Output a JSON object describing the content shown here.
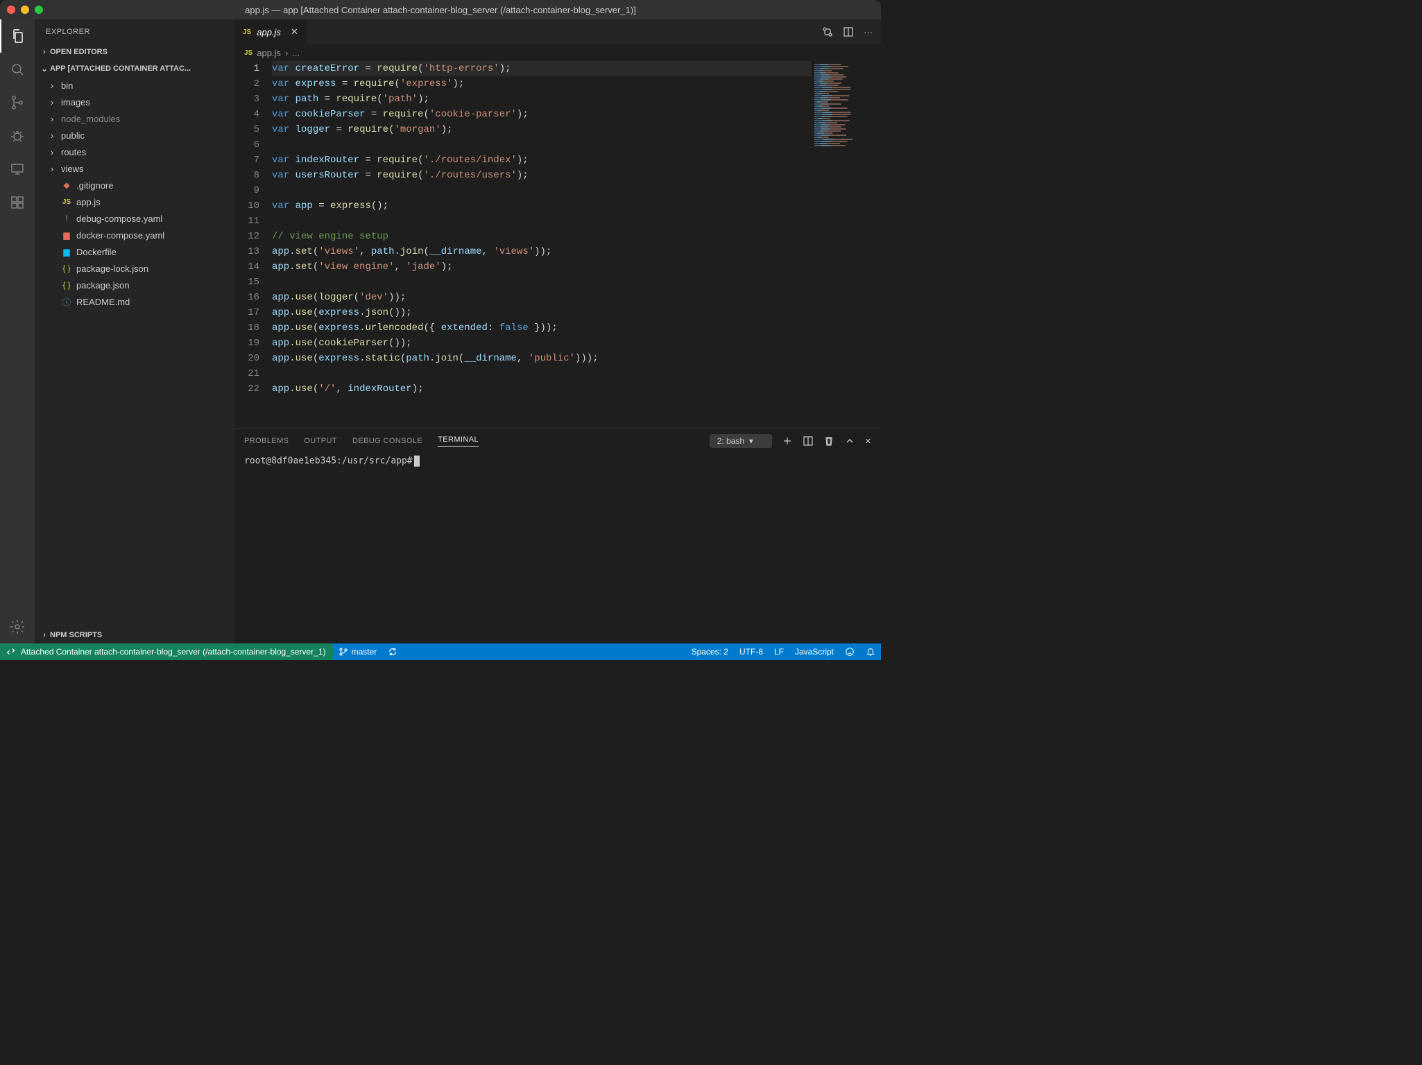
{
  "window": {
    "title": "app.js — app [Attached Container attach-container-blog_server (/attach-container-blog_server_1)]"
  },
  "sidebar": {
    "title": "EXPLORER",
    "open_editors": "OPEN EDITORS",
    "root_label": "APP [ATTACHED CONTAINER ATTAC...",
    "npm_scripts": "NPM SCRIPTS",
    "folders": [
      "bin",
      "images",
      "node_modules",
      "public",
      "routes",
      "views"
    ],
    "files": [
      {
        "name": ".gitignore",
        "icon": "git"
      },
      {
        "name": "app.js",
        "icon": "js"
      },
      {
        "name": "debug-compose.yaml",
        "icon": "yaml"
      },
      {
        "name": "docker-compose.yaml",
        "icon": "docker2"
      },
      {
        "name": "Dockerfile",
        "icon": "docker"
      },
      {
        "name": "package-lock.json",
        "icon": "json"
      },
      {
        "name": "package.json",
        "icon": "json"
      },
      {
        "name": "README.md",
        "icon": "info"
      }
    ]
  },
  "tabs": {
    "active": "app.js"
  },
  "breadcrumb": {
    "file": "app.js",
    "more": "..."
  },
  "code_lines": [
    [
      [
        "kw",
        "var"
      ],
      [
        "",
        " "
      ],
      [
        "id",
        "createError"
      ],
      [
        "",
        " = "
      ],
      [
        "fn",
        "require"
      ],
      [
        "",
        "("
      ],
      [
        "str",
        "'http-errors'"
      ],
      [
        "",
        ");"
      ]
    ],
    [
      [
        "kw",
        "var"
      ],
      [
        "",
        " "
      ],
      [
        "id",
        "express"
      ],
      [
        "",
        " = "
      ],
      [
        "fn",
        "require"
      ],
      [
        "",
        "("
      ],
      [
        "str",
        "'express'"
      ],
      [
        "",
        ");"
      ]
    ],
    [
      [
        "kw",
        "var"
      ],
      [
        "",
        " "
      ],
      [
        "id",
        "path"
      ],
      [
        "",
        " = "
      ],
      [
        "fn",
        "require"
      ],
      [
        "",
        "("
      ],
      [
        "str",
        "'path'"
      ],
      [
        "",
        ");"
      ]
    ],
    [
      [
        "kw",
        "var"
      ],
      [
        "",
        " "
      ],
      [
        "id",
        "cookieParser"
      ],
      [
        "",
        " = "
      ],
      [
        "fn",
        "require"
      ],
      [
        "",
        "("
      ],
      [
        "str",
        "'cookie-parser'"
      ],
      [
        "",
        ");"
      ]
    ],
    [
      [
        "kw",
        "var"
      ],
      [
        "",
        " "
      ],
      [
        "id",
        "logger"
      ],
      [
        "",
        " = "
      ],
      [
        "fn",
        "require"
      ],
      [
        "",
        "("
      ],
      [
        "str",
        "'morgan'"
      ],
      [
        "",
        ");"
      ]
    ],
    [],
    [
      [
        "kw",
        "var"
      ],
      [
        "",
        " "
      ],
      [
        "id",
        "indexRouter"
      ],
      [
        "",
        " = "
      ],
      [
        "fn",
        "require"
      ],
      [
        "",
        "("
      ],
      [
        "str",
        "'./routes/index'"
      ],
      [
        "",
        ");"
      ]
    ],
    [
      [
        "kw",
        "var"
      ],
      [
        "",
        " "
      ],
      [
        "id",
        "usersRouter"
      ],
      [
        "",
        " = "
      ],
      [
        "fn",
        "require"
      ],
      [
        "",
        "("
      ],
      [
        "str",
        "'./routes/users'"
      ],
      [
        "",
        ");"
      ]
    ],
    [],
    [
      [
        "kw",
        "var"
      ],
      [
        "",
        " "
      ],
      [
        "id",
        "app"
      ],
      [
        "",
        " = "
      ],
      [
        "fn",
        "express"
      ],
      [
        "",
        "();"
      ]
    ],
    [],
    [
      [
        "com",
        "// view engine setup"
      ]
    ],
    [
      [
        "id",
        "app"
      ],
      [
        "",
        "."
      ],
      [
        "fn",
        "set"
      ],
      [
        "",
        "("
      ],
      [
        "str",
        "'views'"
      ],
      [
        "",
        ", "
      ],
      [
        "id",
        "path"
      ],
      [
        "",
        "."
      ],
      [
        "fn",
        "join"
      ],
      [
        "",
        "("
      ],
      [
        "id",
        "__dirname"
      ],
      [
        "",
        ", "
      ],
      [
        "str",
        "'views'"
      ],
      [
        "",
        "));"
      ]
    ],
    [
      [
        "id",
        "app"
      ],
      [
        "",
        "."
      ],
      [
        "fn",
        "set"
      ],
      [
        "",
        "("
      ],
      [
        "str",
        "'view engine'"
      ],
      [
        "",
        ", "
      ],
      [
        "str",
        "'jade'"
      ],
      [
        "",
        ");"
      ]
    ],
    [],
    [
      [
        "id",
        "app"
      ],
      [
        "",
        "."
      ],
      [
        "fn",
        "use"
      ],
      [
        "",
        "("
      ],
      [
        "fn",
        "logger"
      ],
      [
        "",
        "("
      ],
      [
        "str",
        "'dev'"
      ],
      [
        "",
        "));"
      ]
    ],
    [
      [
        "id",
        "app"
      ],
      [
        "",
        "."
      ],
      [
        "fn",
        "use"
      ],
      [
        "",
        "("
      ],
      [
        "id",
        "express"
      ],
      [
        "",
        "."
      ],
      [
        "fn",
        "json"
      ],
      [
        "",
        "());"
      ]
    ],
    [
      [
        "id",
        "app"
      ],
      [
        "",
        "."
      ],
      [
        "fn",
        "use"
      ],
      [
        "",
        "("
      ],
      [
        "id",
        "express"
      ],
      [
        "",
        "."
      ],
      [
        "fn",
        "urlencoded"
      ],
      [
        "",
        "({ "
      ],
      [
        "id",
        "extended"
      ],
      [
        "",
        ": "
      ],
      [
        "kw",
        "false"
      ],
      [
        "",
        " }));"
      ]
    ],
    [
      [
        "id",
        "app"
      ],
      [
        "",
        "."
      ],
      [
        "fn",
        "use"
      ],
      [
        "",
        "("
      ],
      [
        "fn",
        "cookieParser"
      ],
      [
        "",
        "());"
      ]
    ],
    [
      [
        "id",
        "app"
      ],
      [
        "",
        "."
      ],
      [
        "fn",
        "use"
      ],
      [
        "",
        "("
      ],
      [
        "id",
        "express"
      ],
      [
        "",
        "."
      ],
      [
        "fn",
        "static"
      ],
      [
        "",
        "("
      ],
      [
        "id",
        "path"
      ],
      [
        "",
        "."
      ],
      [
        "fn",
        "join"
      ],
      [
        "",
        "("
      ],
      [
        "id",
        "__dirname"
      ],
      [
        "",
        ", "
      ],
      [
        "str",
        "'public'"
      ],
      [
        "",
        ")));"
      ]
    ],
    [],
    [
      [
        "id",
        "app"
      ],
      [
        "",
        "."
      ],
      [
        "fn",
        "use"
      ],
      [
        "",
        "("
      ],
      [
        "str",
        "'/'"
      ],
      [
        "",
        ", "
      ],
      [
        "id",
        "indexRouter"
      ],
      [
        "",
        ");"
      ]
    ]
  ],
  "panel": {
    "tabs": {
      "problems": "PROBLEMS",
      "output": "OUTPUT",
      "debug": "DEBUG CONSOLE",
      "terminal": "TERMINAL"
    },
    "terminal_select": "2: bash",
    "prompt": "root@8df0ae1eb345:/usr/src/app#"
  },
  "status": {
    "remote": "Attached Container attach-container-blog_server (/attach-container-blog_server_1)",
    "branch": "master",
    "spaces": "Spaces: 2",
    "encoding": "UTF-8",
    "eol": "LF",
    "lang": "JavaScript"
  }
}
